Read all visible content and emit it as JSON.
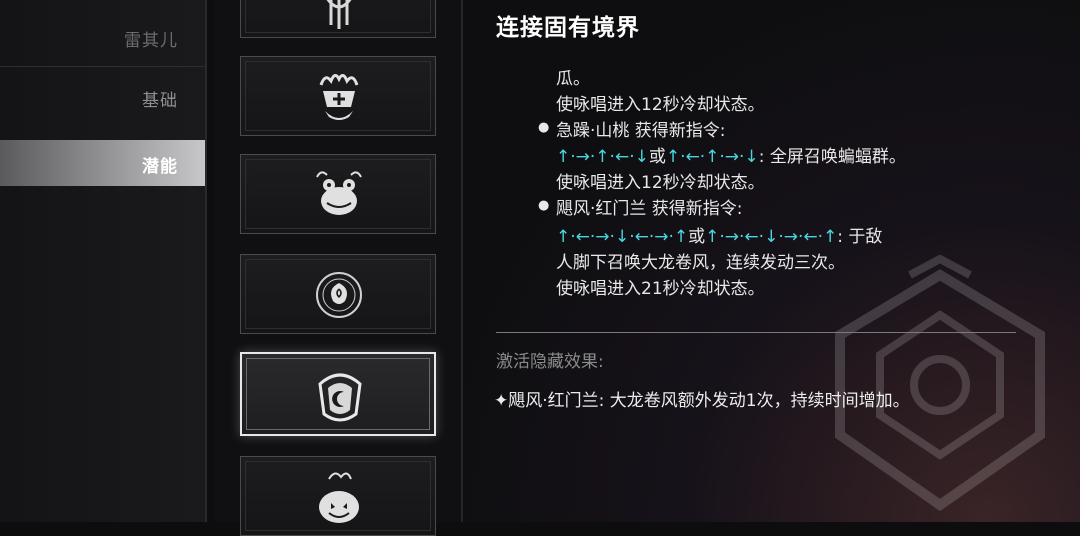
{
  "nav": {
    "items": [
      {
        "label": "雷其儿"
      },
      {
        "label": "基础"
      },
      {
        "label": "潜能",
        "active": true
      }
    ]
  },
  "cards": [
    {
      "icon": "dragon-crest-icon"
    },
    {
      "icon": "spirit-crown-icon"
    },
    {
      "icon": "frog-icon"
    },
    {
      "icon": "rose-seal-icon"
    },
    {
      "icon": "moon-armor-icon",
      "selected": true
    },
    {
      "icon": "pumpkin-icon"
    }
  ],
  "detail": {
    "title": "连接固有境界",
    "lines": {
      "l1": "瓜。",
      "l2": "使咏唱进入12秒冷却状态。",
      "l3": "急躁·山桃 获得新指令:",
      "l4_arrows_a": "↑·→·↑·←·↓",
      "l4_or": "或",
      "l4_arrows_b": "↑·←·↑·→·↓",
      "l4_text": ": 全屏召唤蝙蝠群。",
      "l5": "使咏唱进入12秒冷却状态。",
      "l6": "飓风·红门兰 获得新指令:",
      "l7_arrows_a": "↑·←·→·↓·←·→·↑",
      "l7_or": "或",
      "l7_arrows_b": "↑·→·←·↓·→·←·↑",
      "l7_text": ": 于敌",
      "l8": "人脚下召唤大龙卷风，连续发动三次。",
      "l9": "使咏唱进入21秒冷却状态。"
    },
    "hidden_title": "激活隐藏效果:",
    "hidden_effect": "✦飓风·红门兰: 大龙卷风额外发动1次，持续时间增加。"
  },
  "colors": {
    "accent_cyan": "#4ad6e0",
    "selected_border": "#e8e8e8"
  }
}
